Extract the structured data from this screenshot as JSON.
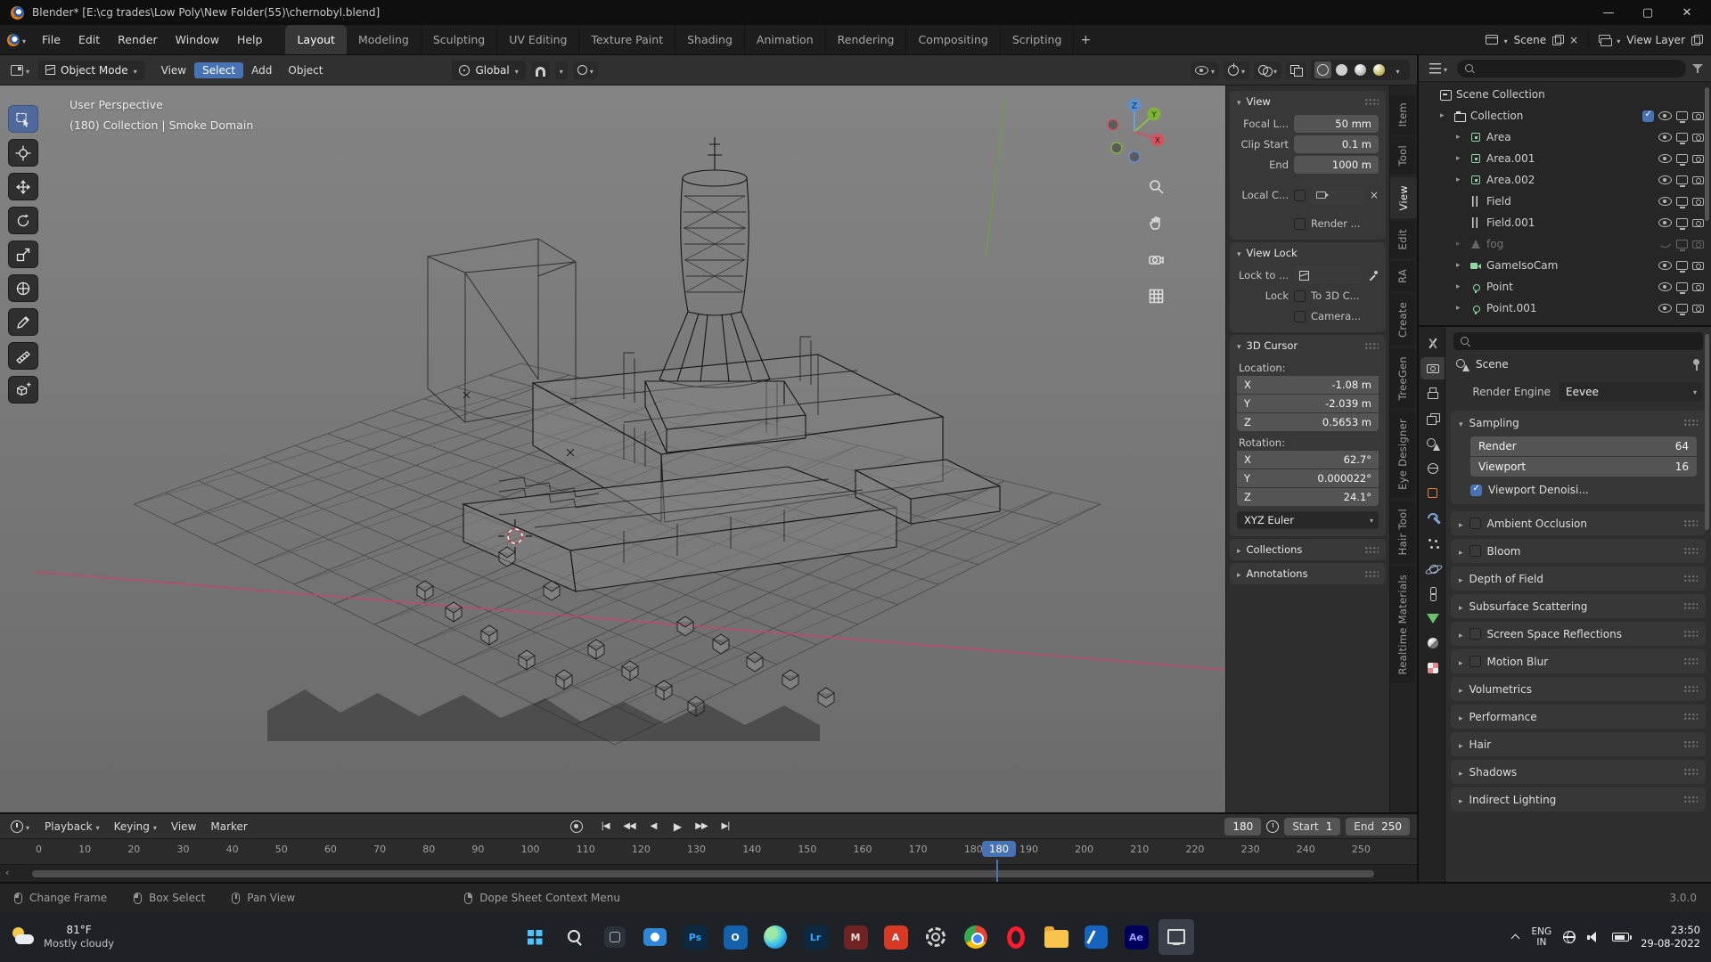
{
  "colors": {
    "accent": "#4772b3",
    "axis-x": "#c2496a",
    "axis-y": "#6aa33c",
    "axis-z": "#4a7ab5",
    "object-orange": "#e8832e"
  },
  "window": {
    "title": "Blender* [E:\\cg trades\\Low Poly\\New Folder(55)\\chernobyl.blend]"
  },
  "topbar": {
    "menus": [
      "File",
      "Edit",
      "Render",
      "Window",
      "Help"
    ],
    "workspaces": [
      {
        "label": "Layout",
        "state": "active"
      },
      {
        "label": "Modeling"
      },
      {
        "label": "Sculpting"
      },
      {
        "label": "UV Editing"
      },
      {
        "label": "Texture Paint"
      },
      {
        "label": "Shading"
      },
      {
        "label": "Animation"
      },
      {
        "label": "Rendering"
      },
      {
        "label": "Compositing"
      },
      {
        "label": "Scripting"
      }
    ],
    "add_workspace": "+",
    "scene_name": "Scene",
    "view_layer_name": "View Layer"
  },
  "viewport": {
    "header": {
      "mode": "Object Mode",
      "menus": [
        {
          "label": "View"
        },
        {
          "label": "Select",
          "state": "active"
        },
        {
          "label": "Add"
        },
        {
          "label": "Object"
        }
      ],
      "orientation": "Global"
    },
    "overlay": {
      "line1": "User Perspective",
      "line2": "(180) Collection | Smoke Domain"
    },
    "gizmo": {
      "x": "X",
      "y": "Y",
      "z": "Z"
    }
  },
  "n_panel": {
    "tabs": [
      {
        "label": "Item"
      },
      {
        "label": "Tool"
      },
      {
        "label": "View",
        "state": "active"
      },
      {
        "label": "Edit"
      },
      {
        "label": "RA"
      },
      {
        "label": "Create"
      },
      {
        "label": "TreeGen"
      },
      {
        "label": "Eye Designer"
      },
      {
        "label": "Hair Tool"
      },
      {
        "label": "Realtime Materials"
      }
    ],
    "view": {
      "title": "View",
      "focal_label": "Focal L...",
      "focal_value": "50 mm",
      "clip_start_label": "Clip Start",
      "clip_start_value": "0.1 m",
      "clip_end_label": "End",
      "clip_end_value": "1000 m",
      "local_camera_label": "Local C...",
      "render_region_label": "Render ..."
    },
    "view_lock": {
      "title": "View Lock",
      "lock_to_label": "Lock to ...",
      "lock_label": "Lock",
      "to_3d_cursor_label": "To 3D C...",
      "camera_label": "Camera..."
    },
    "cursor3d": {
      "title": "3D Cursor",
      "location_label": "Location:",
      "rotation_label": "Rotation:",
      "location": [
        {
          "axis": "X",
          "value": "-1.08 m"
        },
        {
          "axis": "Y",
          "value": "-2.039 m"
        },
        {
          "axis": "Z",
          "value": "0.5653 m"
        }
      ],
      "rotation": [
        {
          "axis": "X",
          "value": "62.7°"
        },
        {
          "axis": "Y",
          "value": "0.000022°"
        },
        {
          "axis": "Z",
          "value": "24.1°"
        }
      ],
      "rotation_mode": "XYZ Euler"
    },
    "collections_title": "Collections",
    "annotations_title": "Annotations"
  },
  "outliner": {
    "root": "Scene Collection",
    "collection": "Collection",
    "items": [
      {
        "label": "Area",
        "icon": "ic-area",
        "arrow": "has"
      },
      {
        "label": "Area.001",
        "icon": "ic-area",
        "arrow": "has"
      },
      {
        "label": "Area.002",
        "icon": "ic-area",
        "arrow": "has"
      },
      {
        "label": "Field",
        "icon": "ic-field"
      },
      {
        "label": "Field.001",
        "icon": "ic-field"
      },
      {
        "label": "fog",
        "icon": "ic-cone",
        "arrow": "has",
        "state": "muted"
      },
      {
        "label": "GameIsoCam",
        "icon": "ic-camobj",
        "arrow": "has"
      },
      {
        "label": "Point",
        "icon": "ic-point",
        "arrow": "has"
      },
      {
        "label": "Point.001",
        "icon": "ic-point",
        "arrow": "has"
      }
    ]
  },
  "properties": {
    "nav_label": "Scene",
    "render_engine_label": "Render Engine",
    "render_engine_value": "Eevee",
    "sampling": {
      "title": "Sampling",
      "render_label": "Render",
      "render_value": "64",
      "viewport_label": "Viewport",
      "viewport_value": "16",
      "denoise_label": "Viewport Denoisi..."
    },
    "panels": [
      {
        "label": "Ambient Occlusion",
        "cb": "has-cb"
      },
      {
        "label": "Bloom",
        "cb": "has-cb"
      },
      {
        "label": "Depth of Field"
      },
      {
        "label": "Subsurface Scattering"
      },
      {
        "label": "Screen Space Reflections",
        "cb": "has-cb"
      },
      {
        "label": "Motion Blur",
        "cb": "has-cb"
      },
      {
        "label": "Volumetrics"
      },
      {
        "label": "Performance"
      },
      {
        "label": "Hair"
      },
      {
        "label": "Shadows"
      },
      {
        "label": "Indirect Lighting"
      }
    ]
  },
  "timeline": {
    "menus": [
      {
        "label": "Playback",
        "caret": "has"
      },
      {
        "label": "Keying",
        "caret": "has"
      },
      {
        "label": "View"
      },
      {
        "label": "Marker"
      }
    ],
    "current_frame": "180",
    "start_label": "Start",
    "start_value": "1",
    "end_label": "End",
    "end_value": "250",
    "ruler": [
      "0",
      "10",
      "20",
      "30",
      "40",
      "50",
      "60",
      "70",
      "80",
      "90",
      "100",
      "110",
      "120",
      "130",
      "140",
      "150",
      "160",
      "170",
      "180",
      "190",
      "200",
      "210",
      "220",
      "230",
      "240",
      "250"
    ]
  },
  "status_bar": {
    "items": [
      {
        "label": "Change Frame",
        "mouse": "lmb"
      },
      {
        "label": "Box Select",
        "mouse": "lmb"
      },
      {
        "label": "Pan View",
        "mouse": "mmb"
      },
      {
        "label": "Dope Sheet Context Menu",
        "mouse": "rmb",
        "gap": "push"
      }
    ],
    "version": "3.0.0"
  },
  "taskbar": {
    "weather_temp": "81°F",
    "weather_desc": "Mostly cloudy",
    "app_glyphs": {
      "photoshop": "Ps",
      "outlook": "O",
      "lightroom": "Lr",
      "m_app": "M",
      "adobe": "A",
      "after_effects": "Ae"
    },
    "tray_lang": "ENG",
    "tray_region": "IN",
    "time": "23:50",
    "date": "29-08-2022"
  }
}
